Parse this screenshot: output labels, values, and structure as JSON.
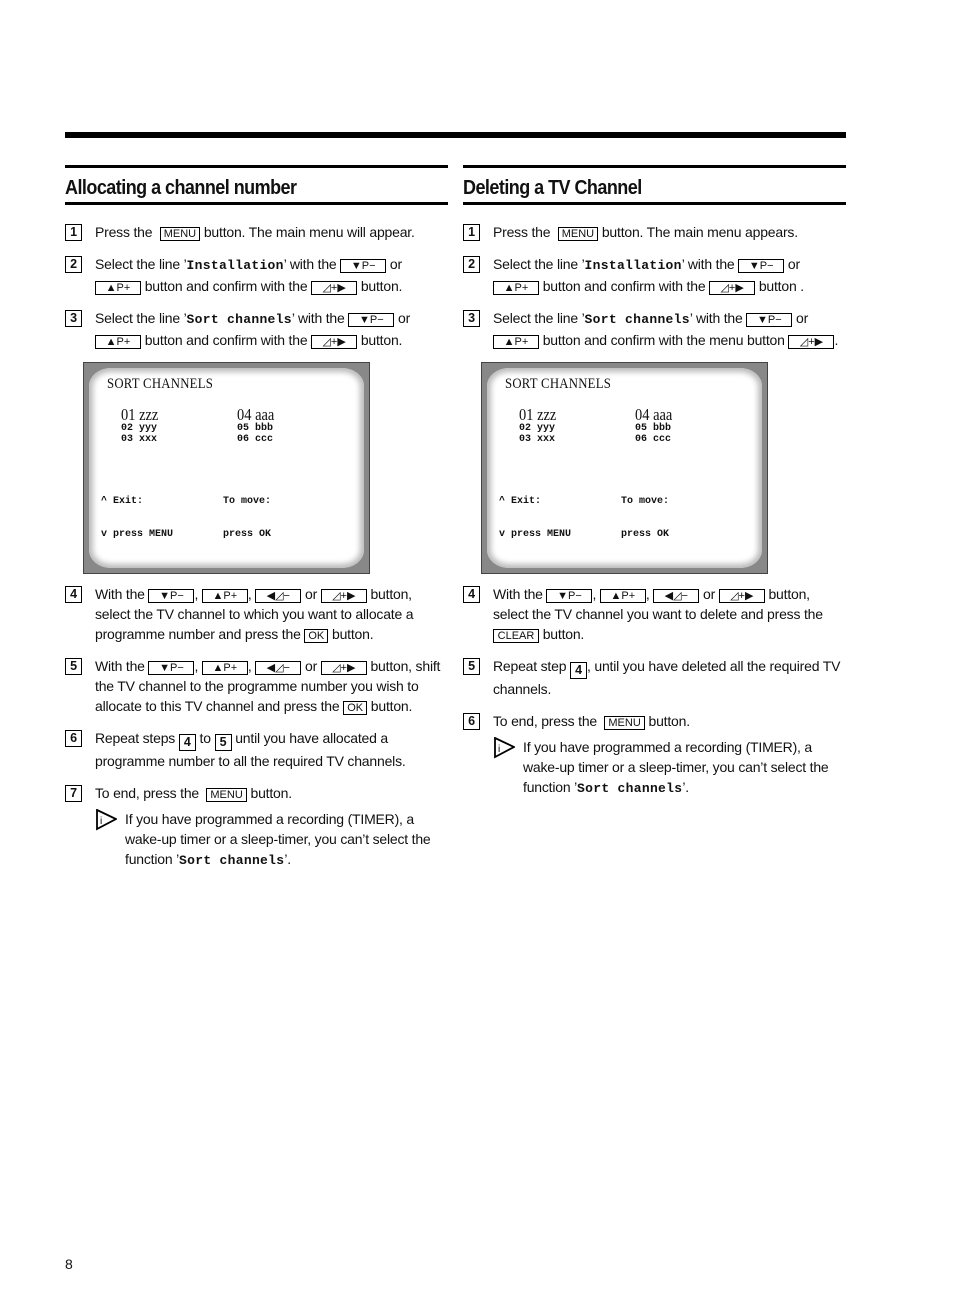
{
  "page_number": "8",
  "keys": {
    "menu": "MENU",
    "p_minus": "▼P−",
    "p_plus": "▲P+",
    "vol_minus": "◀◿−",
    "vol_plus": "◿+▶",
    "ok": "OK",
    "clear": "CLEAR"
  },
  "left": {
    "title": "Allocating a channel number",
    "steps": [
      {
        "num": "1",
        "a": "Press the",
        "b": "button. The main menu will appear."
      },
      {
        "num": "2",
        "a": "Select the line ’",
        "mono": "Installation",
        "b": "’ with the",
        "c": "or",
        "d": "button and confirm with the",
        "e": "button."
      },
      {
        "num": "3",
        "a": "Select the line ’",
        "mono": "Sort channels",
        "b": "’ with the",
        "c": "or",
        "d": "button and confirm with the",
        "e": "button."
      },
      {
        "num": "4",
        "a": "With the",
        "sep1": ",",
        "sep2": ",",
        "or": "or",
        "b": "button, select the TV channel to which you want to allocate a programme number and press the",
        "c": "button."
      },
      {
        "num": "5",
        "a": "With the",
        "sep1": ",",
        "sep2": ",",
        "or": "or",
        "b": "button, shift the TV channel to the programme number you wish to allocate to this TV channel and press the",
        "c": "button."
      },
      {
        "num": "6",
        "a": "Repeat steps",
        "ref1": "4",
        "b": "to",
        "ref2": "5",
        "c": "until you have allocated a programme number to all the required TV channels."
      },
      {
        "num": "7",
        "a": "To end, press the",
        "b": "button."
      }
    ],
    "note": {
      "a": "If you have programmed a recording (TIMER), a wake-up timer or a sleep-timer, you can’t select the function ’",
      "mono": "Sort channels",
      "b": "’."
    }
  },
  "right": {
    "title": "Deleting a TV Channel",
    "steps": [
      {
        "num": "1",
        "a": "Press the",
        "b": "button. The main menu appears."
      },
      {
        "num": "2",
        "a": "Select the line ’",
        "mono": "Installation",
        "b": "’ with the",
        "c": "or",
        "d": "button and confirm with the",
        "e": "button ."
      },
      {
        "num": "3",
        "a": "Select the line ’",
        "mono": "Sort channels",
        "b": "’ with the",
        "c": "or",
        "d": "button and confirm with the menu button",
        "e": "."
      },
      {
        "num": "4",
        "a": "With the",
        "sep1": ",",
        "sep2": ",",
        "or": "or",
        "b": "button, select the TV channel you want to delete and press the",
        "c": "button."
      },
      {
        "num": "5",
        "a": "Repeat step",
        "ref1": "4",
        "b": ",  until you have deleted all the required TV channels."
      },
      {
        "num": "6",
        "a": "To end, press the",
        "b": "button."
      }
    ],
    "note": {
      "a": "If you have programmed a recording (TIMER), a wake-up timer or a sleep-timer, you can’t select the function ’",
      "mono": "Sort channels",
      "b": "’."
    }
  },
  "tv_screen": {
    "title": "SORT CHANNELS",
    "col1": {
      "big": "01 zzz",
      "rows": [
        "02 yyy",
        "03 xxx"
      ]
    },
    "col2": {
      "big": "04 aaa",
      "rows": [
        "05 bbb",
        "06 ccc"
      ]
    },
    "footer_left": [
      "^ Exit:",
      "v press MENU"
    ],
    "footer_right": [
      "To move:",
      "press OK"
    ]
  }
}
